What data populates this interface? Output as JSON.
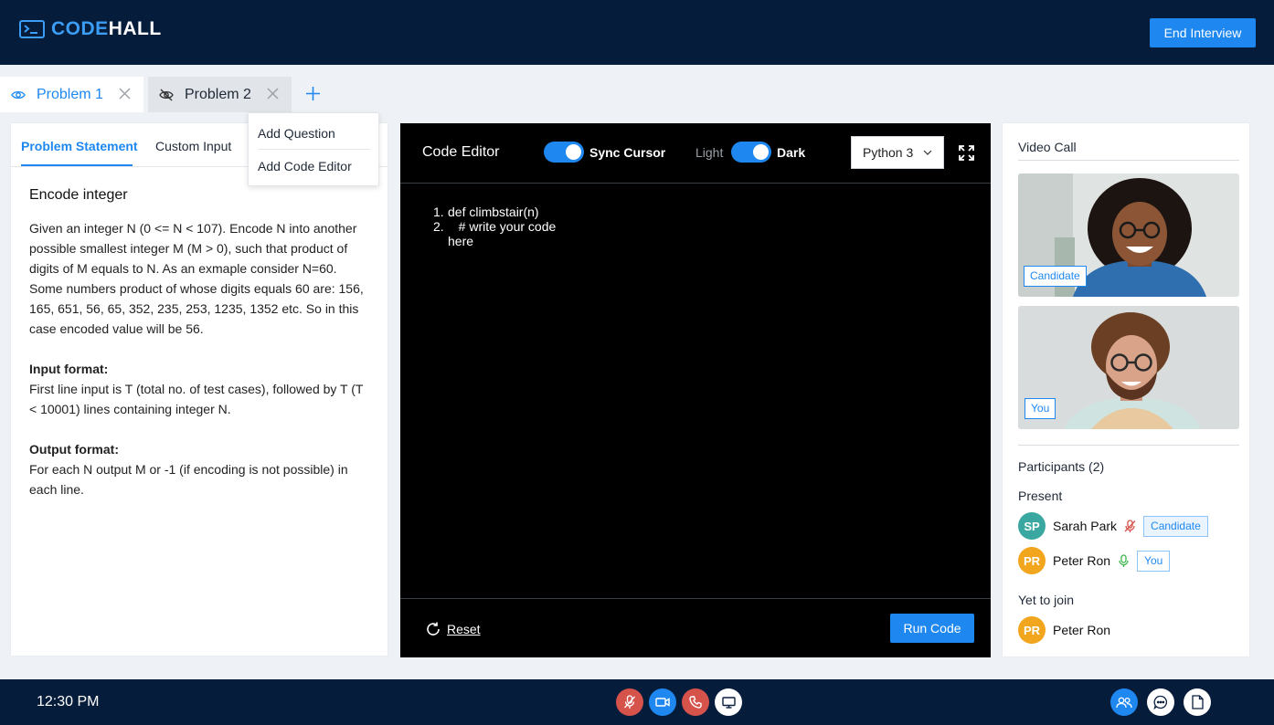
{
  "app": {
    "logo_code": "CODE",
    "logo_hall": "HALL",
    "end_button": "End Interview"
  },
  "tabs": [
    {
      "label": "Problem 1",
      "icon": "eye-icon",
      "active": true
    },
    {
      "label": "Problem 2",
      "icon": "eye-off-icon",
      "active": false
    }
  ],
  "add_menu": {
    "items": [
      "Add Question",
      "Add Code Editor"
    ]
  },
  "problem_panel": {
    "tabs": [
      "Problem Statement",
      "Custom Input"
    ],
    "title": "Encode integer",
    "description": "Given an integer N (0 <= N < 107). Encode N into another possible smallest integer M (M > 0), such that product of digits of M equals to N. As an exmaple consider N=60. Some numbers product of whose digits equals 60 are: 156, 165, 651, 56, 65, 352, 235, 253, 1235, 1352 etc. So in this case encoded value will be 56.",
    "input_heading": "Input format:",
    "input_text": "First line input is T (total no. of test cases), followed by T (T < 10001) lines containing integer N.",
    "output_heading": "Output format:",
    "output_text": "For each N output M or -1 (if encoding is not possible) in each line."
  },
  "editor": {
    "title": "Code Editor",
    "sync_cursor_label": "Sync Cursor",
    "sync_cursor_on": true,
    "theme_light_label": "Light",
    "theme_dark_label": "Dark",
    "theme": "dark",
    "language": "Python 3",
    "code_lines": [
      {
        "num": "1.",
        "text": "def climbstair(n)"
      },
      {
        "num": "2.",
        "text": "   # write your code here"
      }
    ],
    "reset_label": "Reset",
    "run_label": "Run Code"
  },
  "video_panel": {
    "title": "Video Call",
    "videos": [
      {
        "tag": "Candidate"
      },
      {
        "tag": "You"
      }
    ],
    "participants_label": "Participants (2)",
    "present_label": "Present",
    "present": [
      {
        "initials": "SP",
        "name": "Sarah Park",
        "mic": "muted",
        "role": "Candidate"
      },
      {
        "initials": "PR",
        "name": "Peter Ron",
        "mic": "active",
        "role": "You"
      }
    ],
    "yet_to_join_label": "Yet to join",
    "yet_to_join": [
      {
        "initials": "PR",
        "name": "Peter Ron"
      }
    ]
  },
  "bottom_bar": {
    "time": "12:30 PM",
    "controls": [
      "mic-off-icon",
      "video-icon",
      "phone-icon",
      "screen-share-icon"
    ],
    "side_controls": [
      "participants-icon",
      "chat-icon",
      "notes-icon"
    ]
  },
  "colors": {
    "navy": "#061c3b",
    "accent": "#1e88f0",
    "danger": "#d5534b",
    "avatar_sp": "#3aa8a1",
    "avatar_pr": "#f2a61d"
  }
}
